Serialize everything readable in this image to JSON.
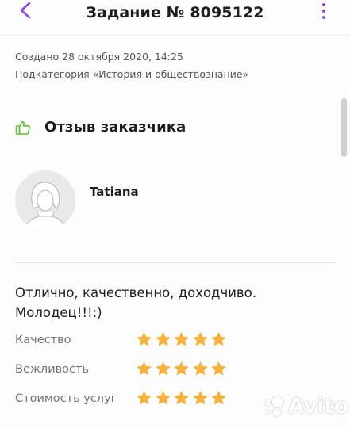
{
  "header": {
    "title": "Задание № 8095122",
    "back_icon": "chevron-left-icon",
    "menu_icon": "more-vertical-icon"
  },
  "meta": {
    "created": "Создано 28 октября 2020, 14:25",
    "subcategory": "Подкатегория «История и обществознание»"
  },
  "review": {
    "icon": "thumbs-up-icon",
    "title": "Отзыв заказчика",
    "author": {
      "name": "Tatiana",
      "avatar_icon": "user-avatar-icon"
    },
    "text": "Отлично, качественно, доходчиво. Молодец!!!:)",
    "ratings": [
      {
        "label": "Качество",
        "stars": 5,
        "max": 5
      },
      {
        "label": "Вежливость",
        "stars": 5,
        "max": 5
      },
      {
        "label": "Стоимость услуг",
        "stars": 5,
        "max": 5
      }
    ]
  },
  "watermark": {
    "text": "Avito"
  },
  "colors": {
    "accent": "#8c4bd8",
    "star": "#f6b23f",
    "thumb": "#5fbf3a",
    "text": "#1d1d1f",
    "muted": "#737378"
  }
}
